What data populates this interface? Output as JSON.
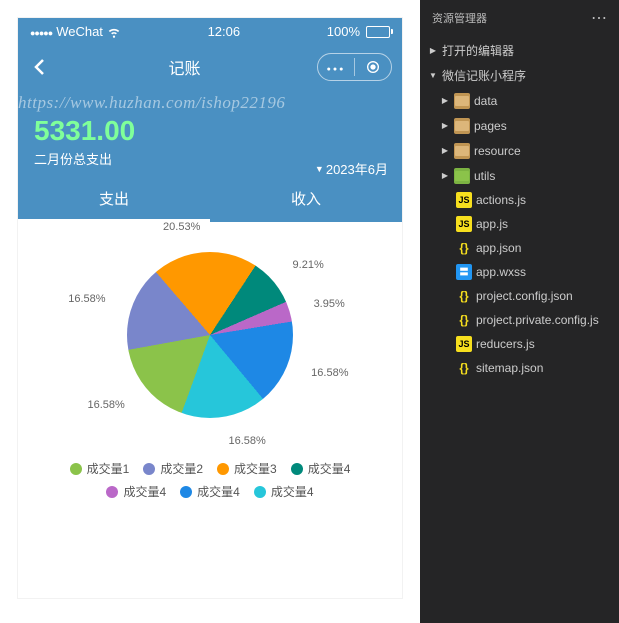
{
  "status": {
    "carrier": "WeChat",
    "time": "12:06",
    "battery": "100%"
  },
  "nav": {
    "title": "记账"
  },
  "summary": {
    "watermark": "https://www.huzhan.com/ishop22196",
    "amount": "5331.00",
    "label": "二月份总支出",
    "month": "2023年6月"
  },
  "tabs": {
    "expense": "支出",
    "income": "收入"
  },
  "legend": {
    "items": [
      "成交量1",
      "成交量2",
      "成交量3",
      "成交量4",
      "成交量4",
      "成交量4",
      "成交量4"
    ]
  },
  "colors": {
    "slices": [
      "#8bc34a",
      "#7986cb",
      "#ff9800",
      "#00897b",
      "#ba68c8",
      "#1e88e5",
      "#26c6da"
    ],
    "legend": [
      "#8bc34a",
      "#7986cb",
      "#ff9800",
      "#00897b",
      "#ba68c8",
      "#1e88e5",
      "#26c6da"
    ]
  },
  "chart_data": {
    "type": "pie",
    "title": "",
    "series": [
      {
        "name": "成交量1",
        "value": 16.58
      },
      {
        "name": "成交量2",
        "value": 16.58
      },
      {
        "name": "成交量3",
        "value": 20.53
      },
      {
        "name": "成交量4",
        "value": 9.21
      },
      {
        "name": "成交量4",
        "value": 3.95
      },
      {
        "name": "成交量4",
        "value": 16.58
      },
      {
        "name": "成交量4",
        "value": 16.58
      }
    ],
    "labels_visible": [
      "16.58%",
      "16.58%",
      "20.53%",
      "9.21%",
      "3.95%",
      "16.58%",
      "16.58%"
    ]
  },
  "explorer": {
    "title": "资源管理器",
    "open_editors": "打开的编辑器",
    "project": "微信记账小程序",
    "folders": {
      "data": "data",
      "pages": "pages",
      "resource": "resource",
      "utils": "utils"
    },
    "files": {
      "actions": "actions.js",
      "app_js": "app.js",
      "app_json": "app.json",
      "app_wxss": "app.wxss",
      "proj_config": "project.config.json",
      "proj_private": "project.private.config.js",
      "reducers": "reducers.js",
      "sitemap": "sitemap.json"
    }
  }
}
